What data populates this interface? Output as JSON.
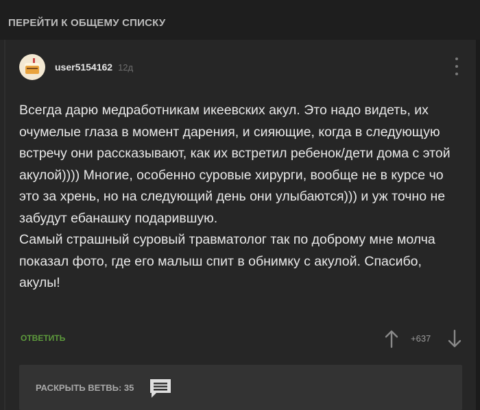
{
  "top_link": {
    "label": "ПЕРЕЙТИ К ОБЩЕМУ СПИСКУ"
  },
  "comment": {
    "author": "user5154162",
    "age": "12д",
    "paragraphs": [
      "Всегда дарю медработникам икеевских акул. Это надо видеть, их очумелые глаза в момент дарения, и сияющие, когда в следующую встречу они рассказывают, как их встретил ребенок/дети дома с этой акулой)))) Многие, особенно суровые хирурги, вообще не в курсе чо это за хрень, но на следующий день они улыбаются))) и уж точно не забудут ебанашку подарившую.",
      "Самый страшный суровый травматолог так по доброму мне молча показал фото, где его малыш спит в обнимку с акулой. Спасибо, акулы!"
    ],
    "reply_label": "ОТВЕТИТЬ",
    "rating": "+637"
  },
  "thread": {
    "expand_label": "РАСКРЫТЬ ВЕТВЬ: 35"
  },
  "icons": {
    "more": "kebab-menu-icon",
    "upvote": "arrow-up-icon",
    "downvote": "arrow-down-icon",
    "comments": "comments-icon"
  },
  "colors": {
    "background": "#1e1e1e",
    "card": "#262626",
    "accent_green": "#5d9a3c",
    "text": "#e8e8e8"
  }
}
